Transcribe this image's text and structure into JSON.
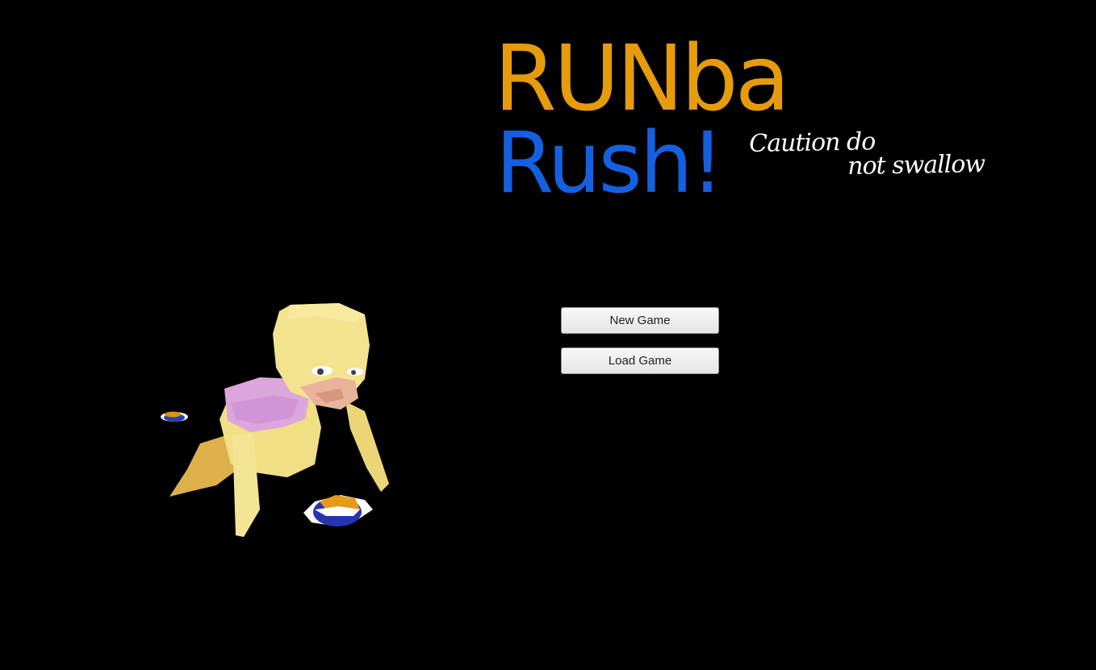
{
  "game": {
    "title_line1": "RUNba",
    "title_line2": "Rush!",
    "tagline_line1": "Caution do",
    "tagline_line2": "not swallow"
  },
  "menu": {
    "new_game_label": "New Game",
    "load_game_label": "Load Game"
  },
  "colors": {
    "background": "#000000",
    "title_line1": "#E59B0C",
    "title_line2": "#1560E0",
    "tagline": "#FFFFFF",
    "button_bg": "#EFEFEF",
    "button_text": "#222222"
  },
  "scene": {
    "character": "crawling-baby-character",
    "items": [
      "candy-pellet",
      "candy-pellet"
    ]
  }
}
